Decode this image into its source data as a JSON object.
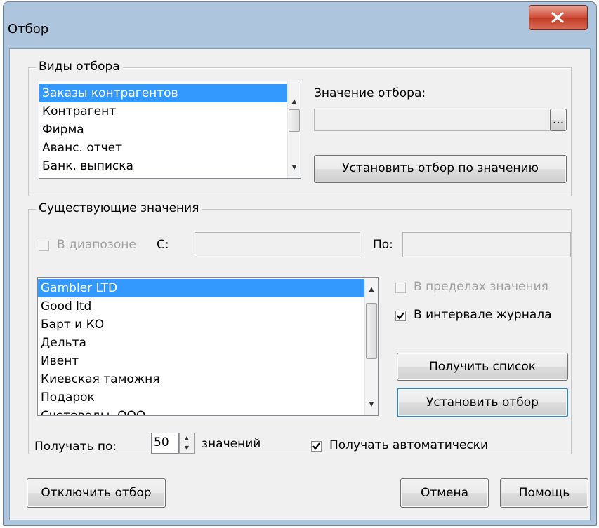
{
  "window": {
    "title": "Отбор",
    "close_label": "X"
  },
  "filter_types": {
    "legend": "Виды отбора",
    "items": [
      "Заказы контрагентов",
      "Контрагент",
      "Фирма",
      "Аванс. отчет",
      "Банк. выписка"
    ],
    "selected_index": 0,
    "value_label": "Значение отбора:",
    "value": "",
    "browse_label": "...",
    "set_by_value_button": "Установить отбор по значению"
  },
  "existing_values": {
    "legend": "Существующие значения",
    "range_checkbox": {
      "label": "В диапозоне",
      "checked": false,
      "enabled": false
    },
    "from_label": "С:",
    "to_label": "По:",
    "from_value": "",
    "to_value": "",
    "items": [
      "Gambler LTD",
      "Good ltd",
      "Барт и КО",
      "Дельта",
      "Ивент",
      "Киевская таможня",
      "Подарок",
      "Счетоводы, ООО"
    ],
    "selected_index": 0,
    "within_value_checkbox": {
      "label": "В пределах значения",
      "checked": false,
      "enabled": false
    },
    "journal_interval_checkbox": {
      "label": "В интервале журнала",
      "checked": true,
      "enabled": true
    },
    "get_list_button": "Получить список",
    "set_filter_button": "Установить отбор",
    "fetch_by_label": "Получать по:",
    "fetch_count": "50",
    "values_label": "значений",
    "auto_fetch_checkbox": {
      "label": "Получать автоматически",
      "checked": true,
      "enabled": true
    }
  },
  "footer": {
    "disable_filter_button": "Отключить отбор",
    "cancel_button": "Отмена",
    "help_button": "Помощь"
  }
}
